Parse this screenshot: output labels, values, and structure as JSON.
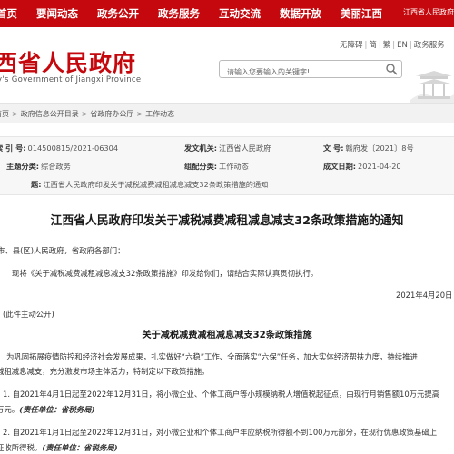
{
  "topnav": {
    "items": [
      "首页",
      "要闻动态",
      "政务公开",
      "政务服务",
      "互动交流",
      "数据开放",
      "美丽江西"
    ],
    "right_text": "江西省人民政府"
  },
  "header": {
    "logo_title": "西省人民政府",
    "logo_subtitle": "y's Government of Jiangxi Province",
    "toplinks": [
      "无障碍",
      "简",
      "繁",
      "EN",
      "政务服务"
    ],
    "search_placeholder": "请输入您要输入的关键字!"
  },
  "breadcrumb": [
    "首页",
    "政府信息公开目录",
    "省政府办公厅",
    "工作动态"
  ],
  "meta": {
    "index_label": "索  引  号:",
    "index_value": "014500815/2021-06304",
    "issuer_label": "发文机关:",
    "issuer_value": "江西省人民政府",
    "docno_label": "文  号:",
    "docno_value": "赣府发〔2021〕8号",
    "topic_label": "主题分类:",
    "topic_value": "综合政务",
    "category_label": "组配分类:",
    "category_value": "工作动态",
    "date_label": "成文日期:",
    "date_value": "2021-04-20",
    "subject_label": "题:",
    "subject_value": "江西省人民政府印发关于减税减费减租减息减支32条政策措施的通知"
  },
  "article": {
    "title": "江西省人民政府印发关于减税减费减租减息减支32条政策措施的通知",
    "salutation": "市、县(区)人民政府，省政府各部门：",
    "intro": "现将《关于减税减费减租减息减支32条政策措施》印发给你们，请结合实际认真贯彻执行。",
    "date": "2021年4月20日",
    "disclosure": "(此件主动公开)",
    "section_title": "关于减税减费减租减息减支32条政策措施",
    "lead_line1": "为巩固拓展疫情防控和经济社会发展成果，扎实做好“六稳”工作、全面落实“六保”任务，加大实体经济帮扶力度，持续推进",
    "lead_line2": "减租减息减支，充分激发市场主体活力，特制定以下政策措施。",
    "item1_line1": "1. 自2021年4月1日起至2022年12月31日，将小微企业、个体工商户等小规模纳税人增值税起征点，由现行月销售额10万元提高",
    "item1_line2": "万元。",
    "item1_resp": "(责任单位：省税务局)",
    "item2_line1": "2. 自2021年1月1日起至2022年12月31日，对小微企业和个体工商户年应纳税所得额不到100万元部分，在现行优惠政策基础上",
    "item2_line2": "征收所得税。",
    "item2_resp": "(责任单位：省税务局)"
  },
  "colors": {
    "brand_red": "#c4080d",
    "breadcrumb_bg": "#f2f2f2",
    "meta_bg": "#f7f7f7"
  },
  "icons": {
    "search": "search-icon",
    "header_decoration": "pavilion-icon"
  }
}
